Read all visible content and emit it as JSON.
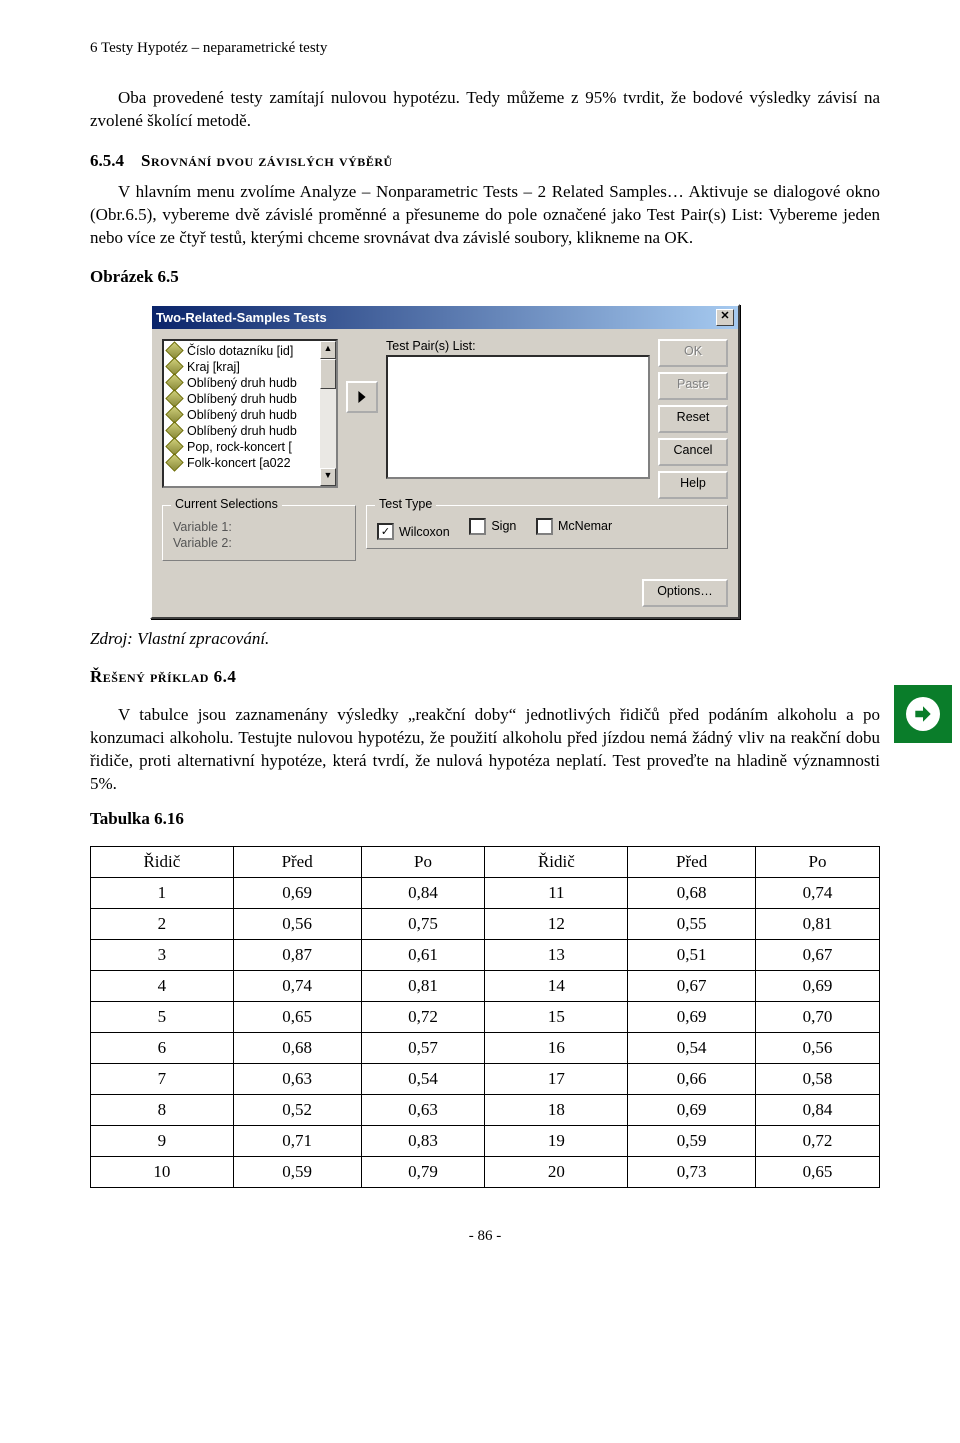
{
  "running_head": "6 Testy Hypotéz – neparametrické testy",
  "para1": "Oba provedené testy zamítají nulovou hypotézu. Tedy můžeme z 95% tvrdit, že bodové výsledky závisí na zvolené školící metodě.",
  "sec_num": "6.5.4",
  "sec_title": "Srovnání dvou závislých výběrů",
  "para2": "V hlavním menu zvolíme Analyze – Nonparametric Tests – 2 Related Samples… Aktivuje se dialogové okno (Obr.6.5), vybereme dvě závislé proměnné a přesuneme do pole označené jako Test Pair(s) List: Vybereme jeden nebo více ze čtyř testů, kterými chceme srovnávat dva závislé soubory, klikneme na OK.",
  "fig_label": "Obrázek 6.5",
  "dialog": {
    "title": "Two-Related-Samples Tests",
    "close": "✕",
    "vars": [
      "Číslo dotazníku [id]",
      "Kraj [kraj]",
      "Oblíbený druh hudb",
      "Oblíbený druh hudb",
      "Oblíbený druh hudb",
      "Oblíbený druh hudb",
      "Pop, rock-koncert [",
      "Folk-koncert [a022"
    ],
    "pair_label": "Test Pair(s) List:",
    "buttons": {
      "ok": "OK",
      "paste": "Paste",
      "reset": "Reset",
      "cancel": "Cancel",
      "help": "Help"
    },
    "cs_legend": "Current Selections",
    "var1": "Variable 1:",
    "var2": "Variable 2:",
    "tt_legend": "Test Type",
    "tests": {
      "wilcoxon": "Wilcoxon",
      "sign": "Sign",
      "mcnemar": "McNemar"
    },
    "wilcoxon_checked": "✓",
    "options": "Options…"
  },
  "source": "Zdroj: Vlastní zpracování.",
  "ex_label": "Řešený příklad 6.4",
  "ex_body": "V tabulce jsou zaznamenány výsledky „reakční doby“ jednotlivých řidičů před podáním alkoholu a po konzumaci alkoholu. Testujte nulovou hypotézu, že použití alkoholu před jízdou nemá žádný vliv na reakční dobu řidiče, proti alternativní hypotéze, která tvrdí, že nulová hypotéza neplatí. Test proveďte na hladině významnosti 5%.",
  "tab_label": "Tabulka 6.16",
  "table": {
    "headers": [
      "Řidič",
      "Před",
      "Po",
      "Řidič",
      "Před",
      "Po"
    ],
    "rows": [
      [
        "1",
        "0,69",
        "0,84",
        "11",
        "0,68",
        "0,74"
      ],
      [
        "2",
        "0,56",
        "0,75",
        "12",
        "0,55",
        "0,81"
      ],
      [
        "3",
        "0,87",
        "0,61",
        "13",
        "0,51",
        "0,67"
      ],
      [
        "4",
        "0,74",
        "0,81",
        "14",
        "0,67",
        "0,69"
      ],
      [
        "5",
        "0,65",
        "0,72",
        "15",
        "0,69",
        "0,70"
      ],
      [
        "6",
        "0,68",
        "0,57",
        "16",
        "0,54",
        "0,56"
      ],
      [
        "7",
        "0,63",
        "0,54",
        "17",
        "0,66",
        "0,58"
      ],
      [
        "8",
        "0,52",
        "0,63",
        "18",
        "0,69",
        "0,84"
      ],
      [
        "9",
        "0,71",
        "0,83",
        "19",
        "0,59",
        "0,72"
      ],
      [
        "10",
        "0,59",
        "0,79",
        "20",
        "0,73",
        "0,65"
      ]
    ]
  },
  "page_num": "- 86 -"
}
